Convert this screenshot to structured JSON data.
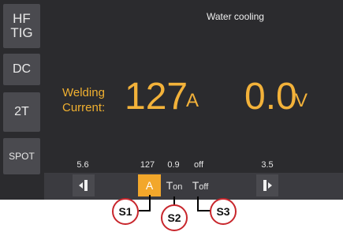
{
  "sidebar": {
    "mode_label": "HF\nTIG",
    "polarity_label": "DC",
    "trigger_label": "2T",
    "spot_label": "SPOT"
  },
  "header": {
    "status": "Water cooling"
  },
  "main": {
    "welding_label_line1": "Welding",
    "welding_label_line2": "Current:",
    "current_value": "127",
    "current_unit": "A",
    "voltage_value": "0.0",
    "voltage_unit": "V"
  },
  "params": {
    "left_value": "5.6",
    "a_value": "127",
    "ton_value": "0.9",
    "toff_value": "off",
    "right_value": "3.5"
  },
  "tabs": {
    "a_label": "A",
    "ton_main": "T",
    "ton_sub": "on",
    "toff_main": "T",
    "toff_sub": "off"
  },
  "callouts": {
    "s1": "S1",
    "s2": "S2",
    "s3": "S3"
  },
  "colors": {
    "accent": "#f2a72b",
    "screen_bg": "#2b2b2e",
    "callout_ring": "#c8262c"
  }
}
